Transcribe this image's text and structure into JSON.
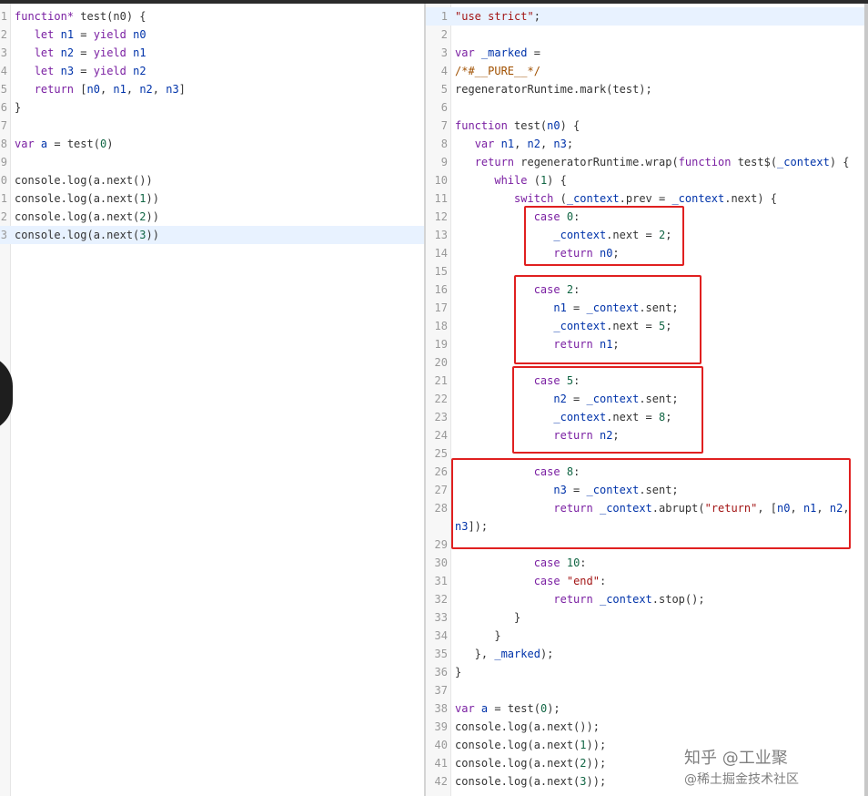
{
  "left_editor": {
    "lines": [
      {
        "n": "1",
        "html": "<span class=\"kw\">function*</span> test(n0) {"
      },
      {
        "n": "2",
        "html": "   <span class=\"kw\">let</span> <span class=\"id\">n1</span> = <span class=\"kw\">yield</span> <span class=\"id\">n0</span>"
      },
      {
        "n": "3",
        "html": "   <span class=\"kw\">let</span> <span class=\"id\">n2</span> = <span class=\"kw\">yield</span> <span class=\"id\">n1</span>"
      },
      {
        "n": "4",
        "html": "   <span class=\"kw\">let</span> <span class=\"id\">n3</span> = <span class=\"kw\">yield</span> <span class=\"id\">n2</span>"
      },
      {
        "n": "5",
        "html": "   <span class=\"kw\">return</span> [<span class=\"id\">n0</span>, <span class=\"id\">n1</span>, <span class=\"id\">n2</span>, <span class=\"id\">n3</span>]"
      },
      {
        "n": "6",
        "html": "}"
      },
      {
        "n": "7",
        "html": ""
      },
      {
        "n": "8",
        "html": "<span class=\"kw\">var</span> <span class=\"id\">a</span> = test(<span class=\"num\">0</span>)"
      },
      {
        "n": "9",
        "html": ""
      },
      {
        "n": "0",
        "html": "console.log(a.next())"
      },
      {
        "n": "1",
        "html": "console.log(a.next(<span class=\"num\">1</span>))"
      },
      {
        "n": "2",
        "html": "console.log(a.next(<span class=\"num\">2</span>))"
      },
      {
        "n": "3",
        "html": "console.log(a.next(<span class=\"num\">3</span>))",
        "hl": true
      }
    ]
  },
  "right_editor": {
    "lines": [
      {
        "n": "1",
        "html": "<span class=\"str\">\"use strict\"</span>;",
        "hl": true
      },
      {
        "n": "2",
        "html": ""
      },
      {
        "n": "3",
        "html": "<span class=\"kw\">var</span> <span class=\"id\">_marked</span> ="
      },
      {
        "n": "4",
        "html": "<span class=\"cm\">/*#__PURE__*/</span>"
      },
      {
        "n": "5",
        "html": "regeneratorRuntime.mark(test);"
      },
      {
        "n": "6",
        "html": ""
      },
      {
        "n": "7",
        "html": "<span class=\"kw\">function</span> test(<span class=\"id\">n0</span>) {"
      },
      {
        "n": "8",
        "html": "   <span class=\"kw\">var</span> <span class=\"id\">n1</span>, <span class=\"id\">n2</span>, <span class=\"id\">n3</span>;"
      },
      {
        "n": "9",
        "html": "   <span class=\"kw\">return</span> regeneratorRuntime.wrap(<span class=\"kw\">function</span> test$(<span class=\"id\">_context</span>) {"
      },
      {
        "n": "10",
        "html": "      <span class=\"kw\">while</span> (<span class=\"num\">1</span>) {"
      },
      {
        "n": "11",
        "html": "         <span class=\"kw\">switch</span> (<span class=\"id\">_context</span>.prev = <span class=\"id\">_context</span>.next) {"
      },
      {
        "n": "12",
        "html": "            <span class=\"kw\">case</span> <span class=\"num\">0</span>:"
      },
      {
        "n": "13",
        "html": "               <span class=\"id\">_context</span>.next = <span class=\"num\">2</span>;"
      },
      {
        "n": "14",
        "html": "               <span class=\"kw\">return</span> <span class=\"id\">n0</span>;"
      },
      {
        "n": "15",
        "html": ""
      },
      {
        "n": "16",
        "html": "            <span class=\"kw\">case</span> <span class=\"num\">2</span>:"
      },
      {
        "n": "17",
        "html": "               <span class=\"id\">n1</span> = <span class=\"id\">_context</span>.sent;"
      },
      {
        "n": "18",
        "html": "               <span class=\"id\">_context</span>.next = <span class=\"num\">5</span>;"
      },
      {
        "n": "19",
        "html": "               <span class=\"kw\">return</span> <span class=\"id\">n1</span>;"
      },
      {
        "n": "20",
        "html": ""
      },
      {
        "n": "21",
        "html": "            <span class=\"kw\">case</span> <span class=\"num\">5</span>:"
      },
      {
        "n": "22",
        "html": "               <span class=\"id\">n2</span> = <span class=\"id\">_context</span>.sent;"
      },
      {
        "n": "23",
        "html": "               <span class=\"id\">_context</span>.next = <span class=\"num\">8</span>;"
      },
      {
        "n": "24",
        "html": "               <span class=\"kw\">return</span> <span class=\"id\">n2</span>;"
      },
      {
        "n": "25",
        "html": ""
      },
      {
        "n": "26",
        "html": "            <span class=\"kw\">case</span> <span class=\"num\">8</span>:"
      },
      {
        "n": "27",
        "html": "               <span class=\"id\">n3</span> = <span class=\"id\">_context</span>.sent;"
      },
      {
        "n": "28",
        "html": "               <span class=\"kw\">return</span> <span class=\"id\">_context</span>.abrupt(<span class=\"str\">\"return\"</span>, [<span class=\"id\">n0</span>, <span class=\"id\">n1</span>, <span class=\"id\">n2</span>,"
      },
      {
        "n": "",
        "html": "<span class=\"id\">n3</span>]);"
      },
      {
        "n": "29",
        "html": ""
      },
      {
        "n": "30",
        "html": "            <span class=\"kw\">case</span> <span class=\"num\">10</span>:"
      },
      {
        "n": "31",
        "html": "            <span class=\"kw\">case</span> <span class=\"str\">\"end\"</span>:"
      },
      {
        "n": "32",
        "html": "               <span class=\"kw\">return</span> <span class=\"id\">_context</span>.stop();"
      },
      {
        "n": "33",
        "html": "         }"
      },
      {
        "n": "34",
        "html": "      }"
      },
      {
        "n": "35",
        "html": "   }, <span class=\"id\">_marked</span>);"
      },
      {
        "n": "36",
        "html": "}"
      },
      {
        "n": "37",
        "html": ""
      },
      {
        "n": "38",
        "html": "<span class=\"kw\">var</span> <span class=\"id\">a</span> = test(<span class=\"num\">0</span>);"
      },
      {
        "n": "39",
        "html": "console.log(a.next());"
      },
      {
        "n": "40",
        "html": "console.log(a.next(<span class=\"num\">1</span>));"
      },
      {
        "n": "41",
        "html": "console.log(a.next(<span class=\"num\">2</span>));"
      },
      {
        "n": "42",
        "html": "console.log(a.next(<span class=\"num\">3</span>));"
      }
    ]
  },
  "annotations": {
    "boxes": [
      "case 0",
      "case 2",
      "case 5",
      "case 8"
    ],
    "box_color": "#e02020"
  },
  "watermark": {
    "text": "知乎 @工业聚",
    "sub": "@稀土掘金技术社区"
  },
  "colors": {
    "keyword": "#7a1fa2",
    "string": "#a31515",
    "number": "#116644",
    "comment": "#a05000",
    "identifier": "#0033aa",
    "highlight_line": "#e8f2ff"
  }
}
